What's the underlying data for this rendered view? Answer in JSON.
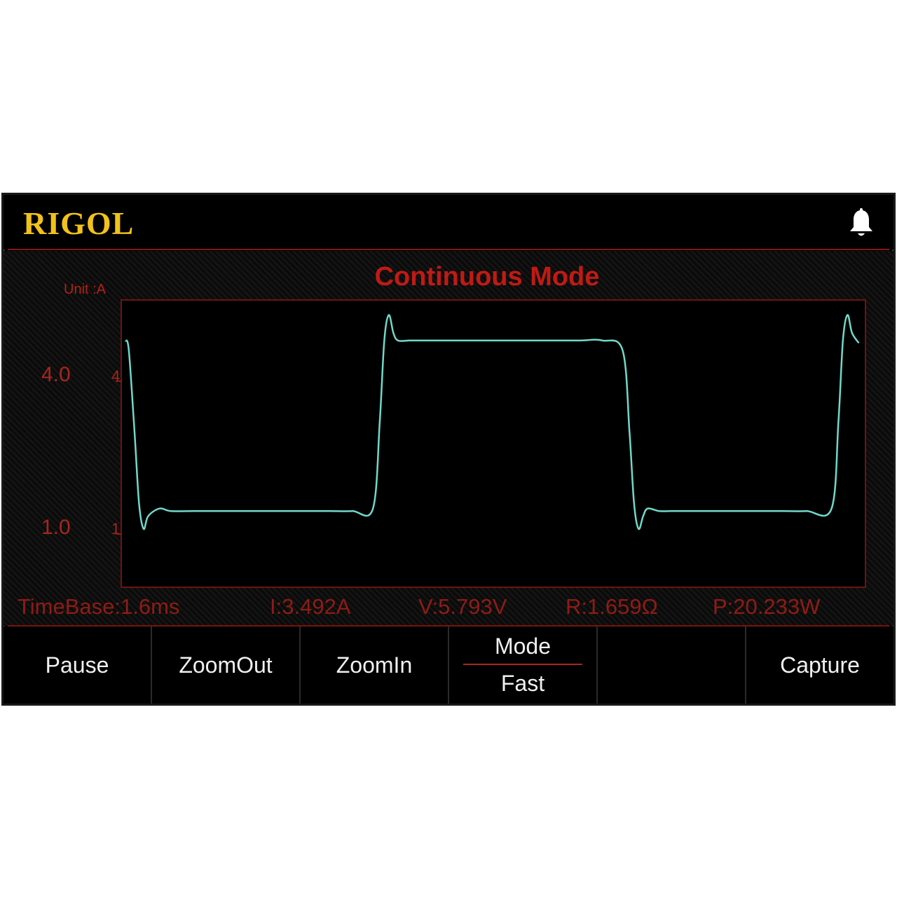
{
  "header": {
    "logo_text": "RIGOL",
    "bell_icon": "bell-icon"
  },
  "display": {
    "mode_title": "Continuous Mode",
    "unit_label": "Unit :A",
    "y_ticks": [
      {
        "value": 4.0,
        "label": "4.0",
        "small": "4"
      },
      {
        "value": 1.0,
        "label": "1.0",
        "small": "1"
      }
    ]
  },
  "status": {
    "timebase": "TimeBase:1.6ms",
    "current": "I:3.492A",
    "voltage": "V:5.793V",
    "resistance": "R:1.659Ω",
    "power": "P:20.233W"
  },
  "softkeys": {
    "pause": "Pause",
    "zoom_out": "ZoomOut",
    "zoom_in": "ZoomIn",
    "mode_label": "Mode",
    "mode_value": "Fast",
    "blank": "",
    "capture": "Capture"
  },
  "colors": {
    "trace": "#6fd9c9",
    "accent_red": "#c01a14",
    "logo_yellow": "#f2c21a"
  },
  "chart_data": {
    "type": "line",
    "ylabel": "Unit :A",
    "yticks": [
      1.0,
      4.0
    ],
    "ylim": [
      0.5,
      5.5
    ],
    "series": [
      {
        "x": [
          0,
          3,
          8,
          12,
          16,
          20,
          30,
          40,
          60,
          80,
          100,
          120,
          140,
          160,
          180,
          200,
          218,
          224,
          228,
          232,
          236,
          240,
          250,
          260,
          280,
          300,
          320,
          340,
          360,
          380,
          400,
          420,
          438,
          444,
          448,
          452,
          456,
          460,
          470,
          480,
          500,
          520,
          540,
          560,
          580,
          600,
          622,
          628,
          632,
          636,
          640,
          646
        ],
        "y": [
          4.8,
          4.6,
          3.0,
          1.6,
          1.1,
          1.35,
          1.5,
          1.45,
          1.45,
          1.45,
          1.45,
          1.45,
          1.45,
          1.45,
          1.45,
          1.45,
          1.5,
          3.2,
          4.8,
          5.3,
          4.95,
          4.8,
          4.8,
          4.8,
          4.8,
          4.8,
          4.8,
          4.8,
          4.8,
          4.8,
          4.8,
          4.8,
          4.6,
          3.0,
          1.6,
          1.1,
          1.35,
          1.5,
          1.45,
          1.45,
          1.45,
          1.45,
          1.45,
          1.45,
          1.45,
          1.45,
          1.5,
          3.2,
          4.8,
          5.3,
          4.95,
          4.75
        ]
      }
    ]
  }
}
